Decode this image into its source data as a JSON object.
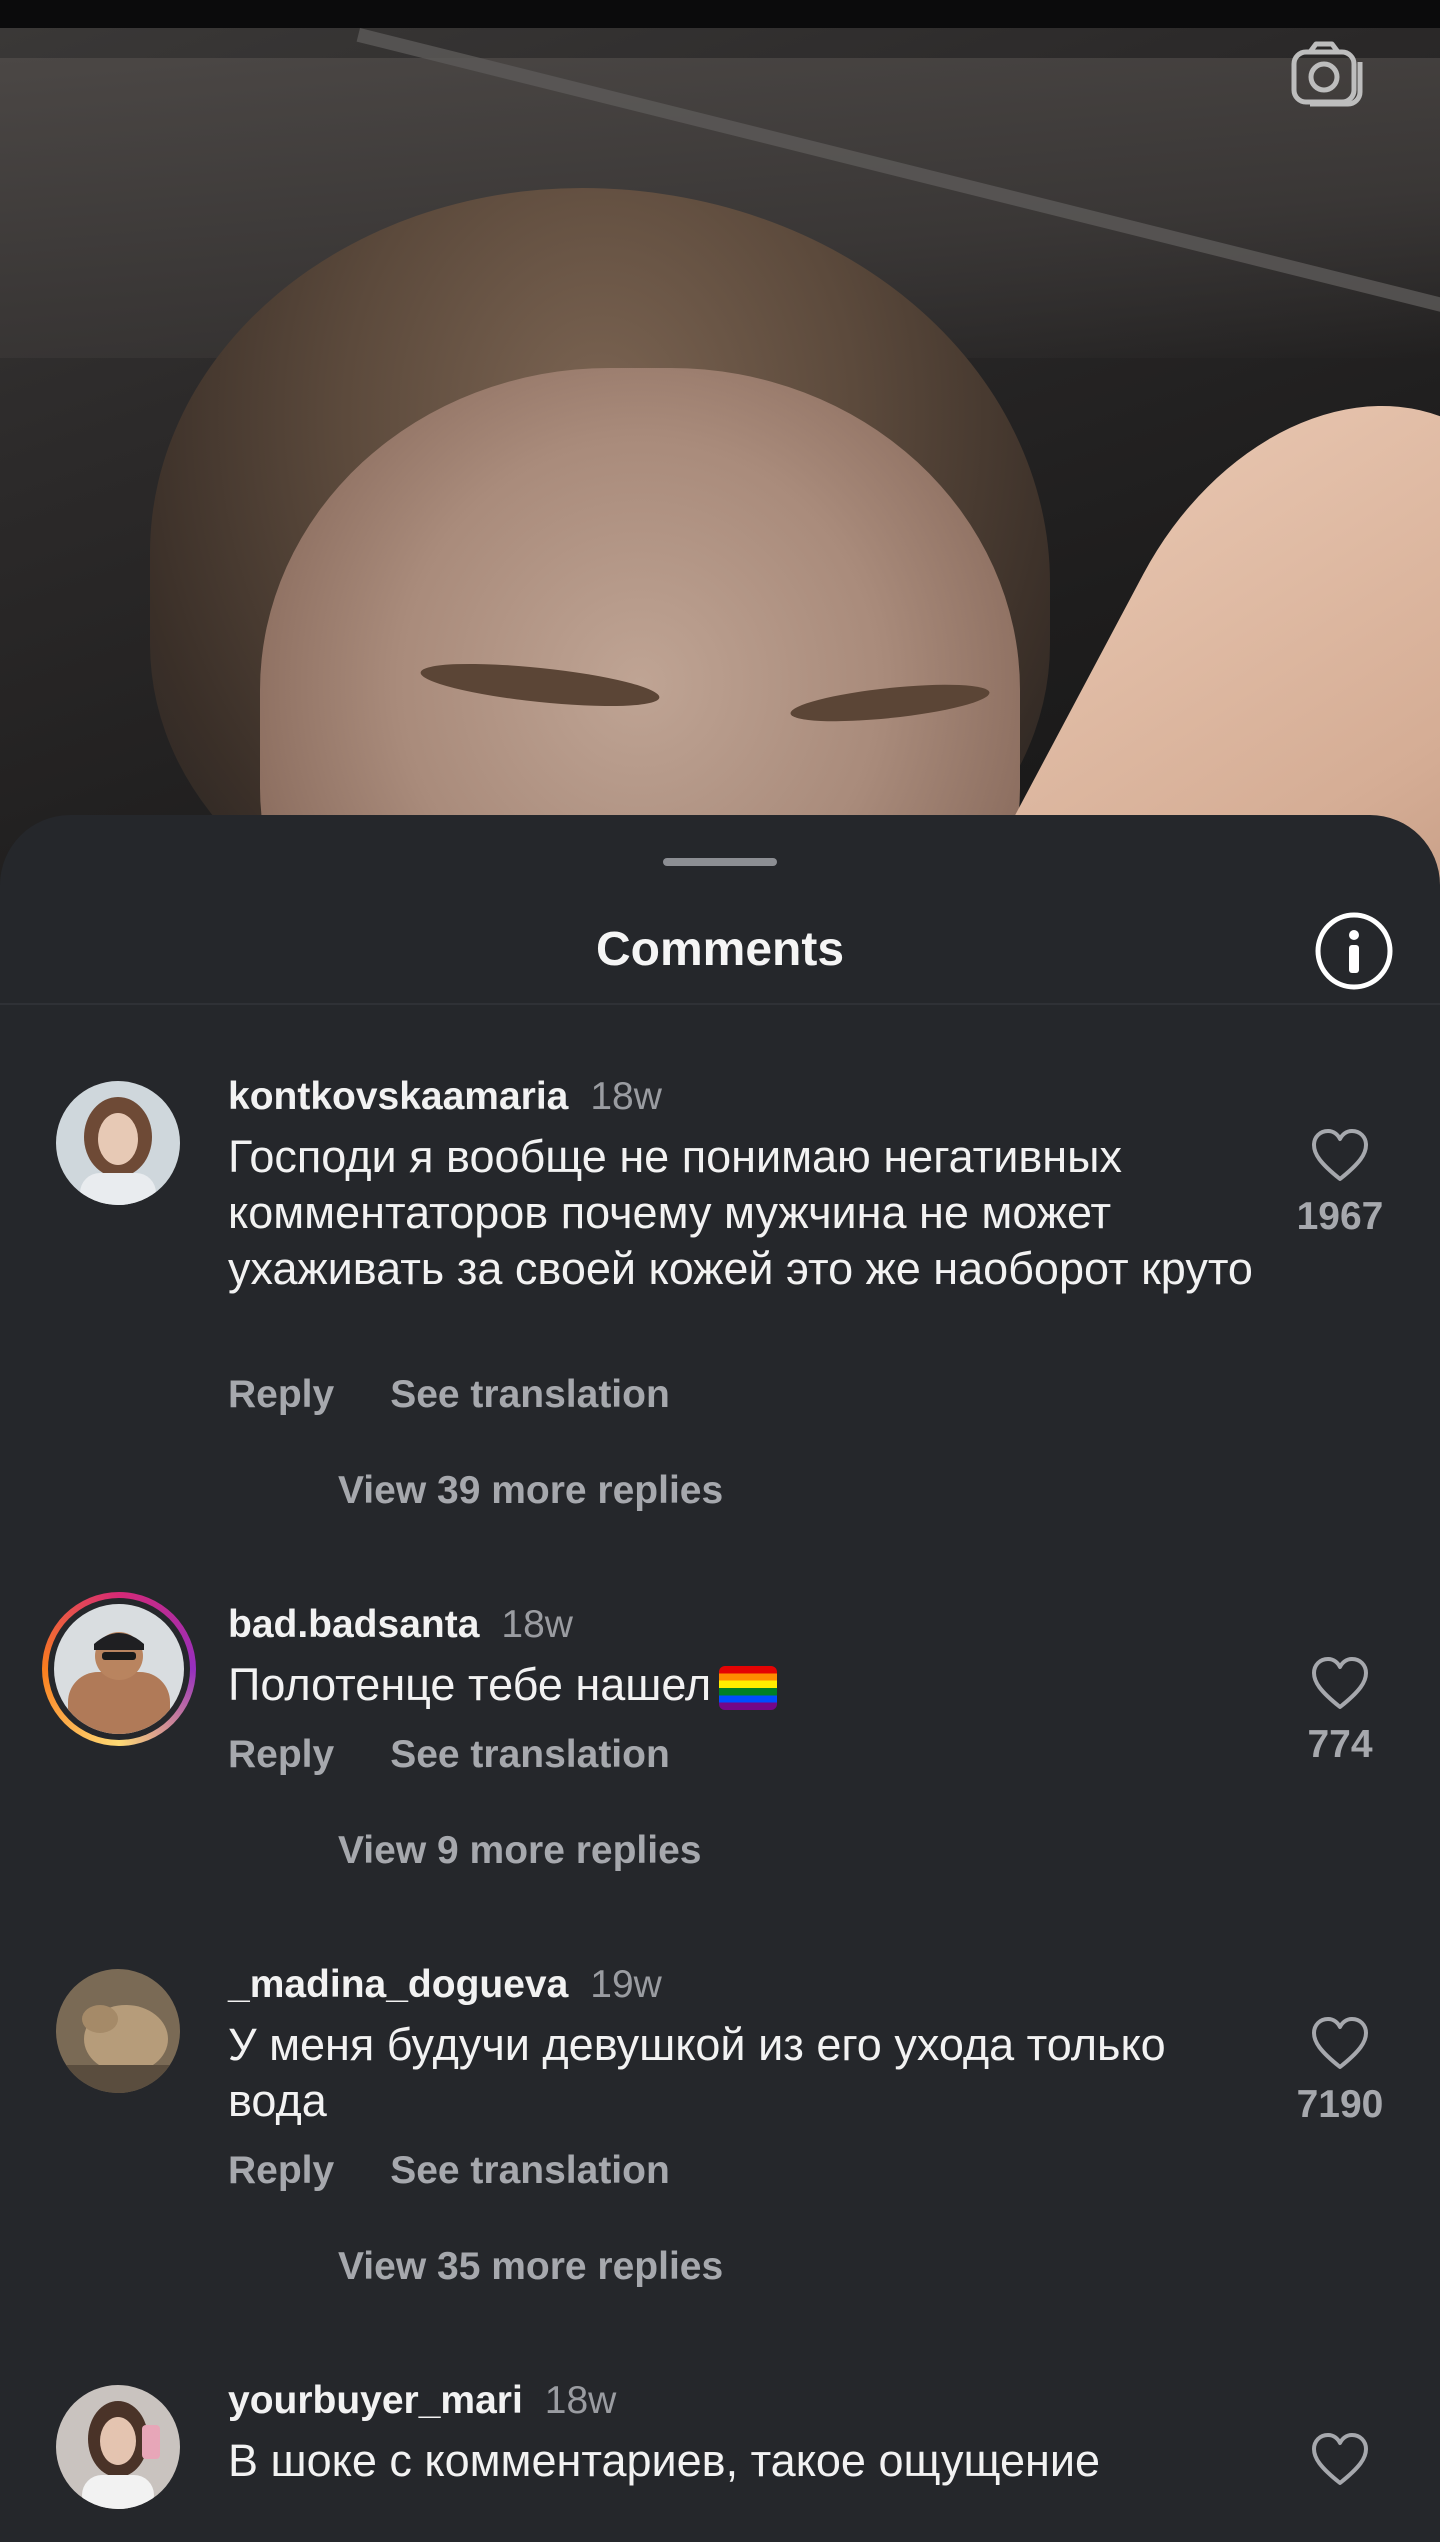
{
  "sheet": {
    "title": "Comments"
  },
  "comments": [
    {
      "username": "kontkovskaamaria",
      "time": "18w",
      "text": "Господи я вообще не понимаю негативных комментаторов почему мужчина не может ухаживать за своей кожей это же наоборот круто",
      "reply_label": "Reply",
      "translate_label": "See translation",
      "view_replies": "View 39 more replies",
      "likes": "1967",
      "avatar_icon": "avatar-photo"
    },
    {
      "username": "bad.badsanta",
      "time": "18w",
      "text": "Полотенце тебе нашел",
      "emoji": "rainbow-flag",
      "reply_label": "Reply",
      "translate_label": "See translation",
      "view_replies": "View 9 more replies",
      "likes": "774",
      "avatar_icon": "avatar-photo-story"
    },
    {
      "username": "_madina_dogueva",
      "time": "19w",
      "text": "У меня будучи девушкой из его ухода только вода",
      "reply_label": "Reply",
      "translate_label": "See translation",
      "view_replies": "View 35 more replies",
      "likes": "7190",
      "avatar_icon": "avatar-photo"
    },
    {
      "username": "yourbuyer_mari",
      "time": "18w",
      "text": "В шоке с комментариев, такое ощущение",
      "likes": "",
      "avatar_icon": "avatar-photo"
    }
  ],
  "colors": {
    "sheet_bg": "#25272b",
    "text_primary": "#f2f2f2",
    "text_secondary": "#a6a8ad"
  }
}
